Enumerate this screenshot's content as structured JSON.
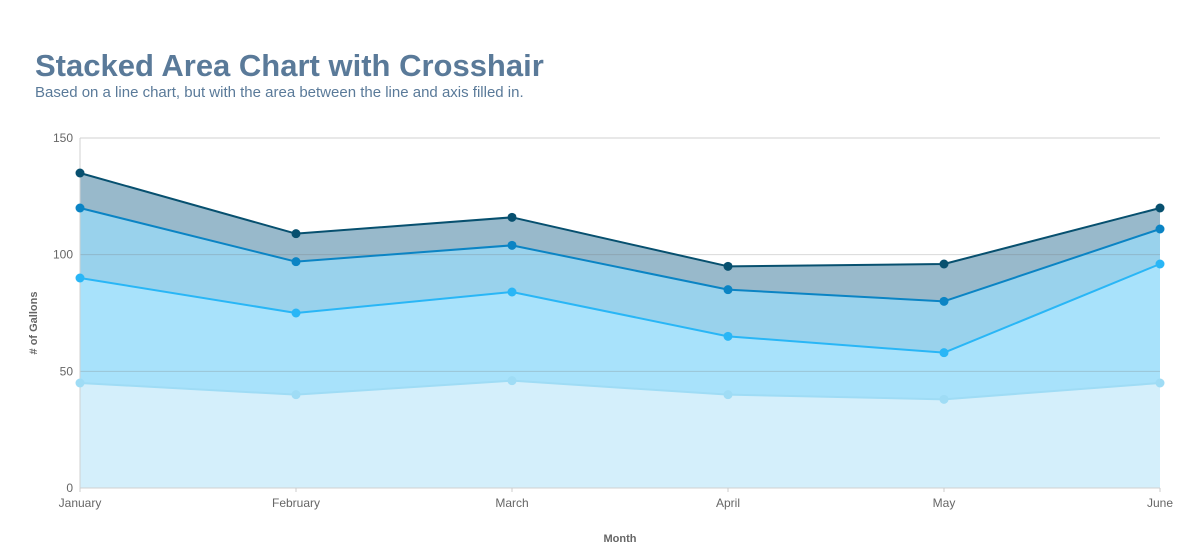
{
  "title": "Stacked Area Chart with Crosshair",
  "subtitle": "Based on a line chart, but with the area between the line and axis filled in.",
  "chart_data": {
    "type": "area",
    "stacked": true,
    "title": "Stacked Area Chart with Crosshair",
    "subtitle": "Based on a line chart, but with the area between the line and axis filled in.",
    "xlabel": "Month",
    "ylabel": "# of Gallons",
    "categories": [
      "January",
      "February",
      "March",
      "April",
      "May",
      "June"
    ],
    "ylim": [
      0,
      150
    ],
    "yticks": [
      0,
      50,
      100,
      150
    ],
    "grid": true,
    "legend": "none",
    "series": [
      {
        "values": [
          45,
          40,
          46,
          40,
          38,
          45
        ],
        "color": "#9fdcf5"
      },
      {
        "values": [
          45,
          35,
          38,
          25,
          20,
          51
        ],
        "color": "#29b6f6"
      },
      {
        "values": [
          30,
          22,
          20,
          20,
          22,
          15
        ],
        "color": "#0b84c4"
      },
      {
        "values": [
          15,
          12,
          12,
          10,
          16,
          9
        ],
        "color": "#07506f"
      }
    ],
    "fill_colors": [
      "#d4effb",
      "#a8e2fb",
      "#99d2ec",
      "#98b9cb"
    ]
  }
}
